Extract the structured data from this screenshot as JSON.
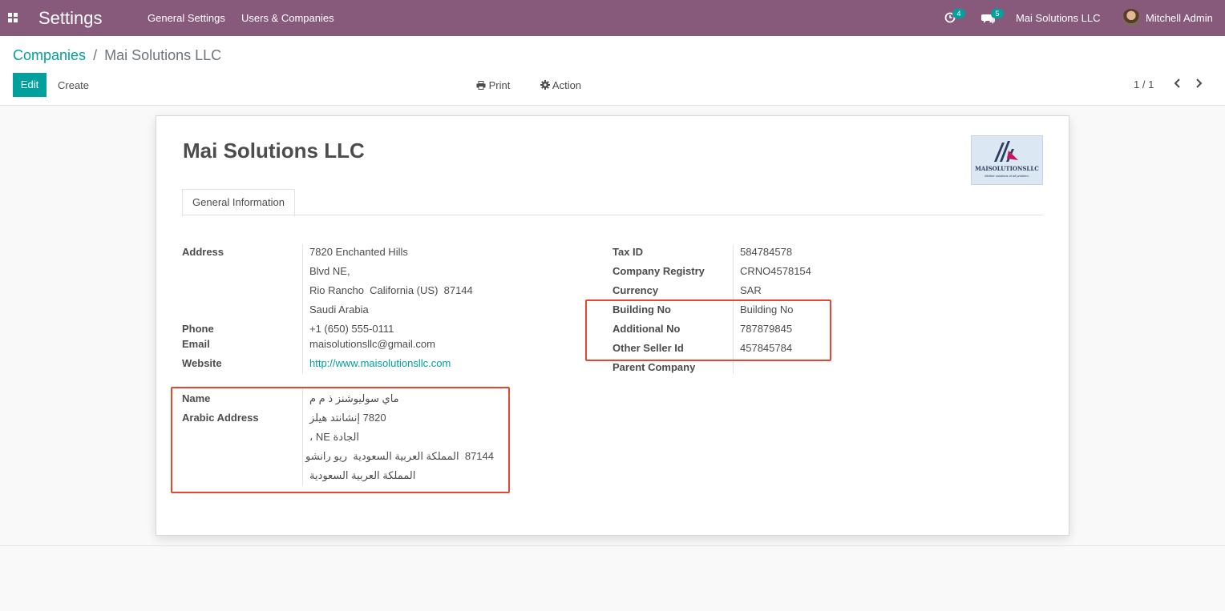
{
  "navbar": {
    "app_title": "Settings",
    "menu": [
      "General Settings",
      "Users & Companies"
    ],
    "activity_count": "4",
    "messages_count": "5",
    "company": "Mai Solutions LLC",
    "user": "Mitchell Admin"
  },
  "breadcrumb": {
    "parent": "Companies",
    "separator": "/",
    "current": "Mai Solutions LLC"
  },
  "toolbar": {
    "edit": "Edit",
    "create": "Create",
    "print": "Print",
    "action": "Action",
    "pager": "1 / 1"
  },
  "record": {
    "name": "Mai Solutions LLC",
    "logo_text": "MAISOLUTIONSLLC",
    "logo_tagline": "Mother solutions of all problem.",
    "tab": "General Information",
    "labels": {
      "address": "Address",
      "phone": "Phone",
      "email": "Email",
      "website": "Website",
      "arabic_name": "Name",
      "arabic_address": "Arabic Address",
      "tax_id": "Tax ID",
      "company_registry": "Company Registry",
      "currency": "Currency",
      "building_no": "Building No",
      "additional_no": "Additional No",
      "other_seller_id": "Other Seller Id",
      "parent_company": "Parent Company"
    },
    "address": [
      "7820 Enchanted Hills",
      "Blvd NE,",
      "Rio Rancho  California (US)  87144",
      "Saudi Arabia"
    ],
    "phone": "+1 (650) 555-0111",
    "email": "maisolutionsllc@gmail.com",
    "website": "http://www.maisolutionsllc.com",
    "arabic_name": "ماي سوليوشنز ذ م م",
    "arabic_address": [
      "7820 إنشانتد هيلز",
      "الجادة NE ،",
      "87144  المملكة العربية السعودية  ريو رانشو",
      "المملكة العربية السعودية"
    ],
    "tax_id": "584784578",
    "company_registry": "CRNO4578154",
    "currency": "SAR",
    "building_no": "Building No",
    "additional_no": "787879845",
    "other_seller_id": "457845784",
    "parent_company": ""
  },
  "colors": {
    "brand": "#875a7b",
    "accent": "#00a09d",
    "highlight": "#e8452f"
  }
}
